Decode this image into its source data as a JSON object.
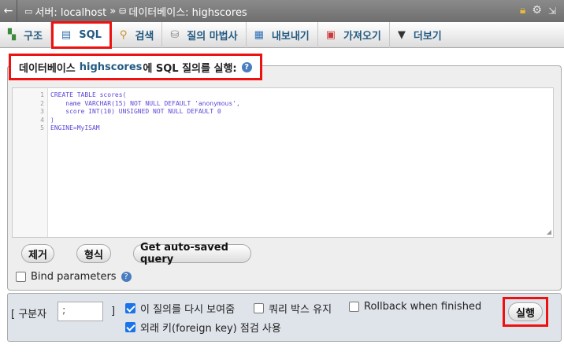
{
  "breadcrumb": {
    "server_label": "서버: localhost",
    "separator": "»",
    "database_label": "데이터베이스: highscores"
  },
  "icons": {
    "back": "back-arrow-icon",
    "server": "server-icon",
    "database": "database-icon",
    "lock": "lock-icon",
    "settings": "gear-icon",
    "collapse": "collapse-icon"
  },
  "tabs": [
    {
      "label": "구조",
      "icon": "structure-icon"
    },
    {
      "label": "SQL",
      "icon": "sql-icon",
      "active": true
    },
    {
      "label": "검색",
      "icon": "search-icon"
    },
    {
      "label": "질의 마법사",
      "icon": "query-icon"
    },
    {
      "label": "내보내기",
      "icon": "export-icon"
    },
    {
      "label": "가져오기",
      "icon": "import-icon"
    },
    {
      "label": "더보기",
      "icon": "caret-down-icon"
    }
  ],
  "sql_panel": {
    "legend_prefix": "데이터베이스",
    "database_name": "highscores",
    "legend_suffix": "에 SQL 질의를 실행:",
    "line_numbers": [
      "1",
      "2",
      "3",
      "4",
      "5"
    ],
    "code_lines": [
      "CREATE TABLE scores(",
      "    name VARCHAR(15) NOT NULL DEFAULT 'anonymous',",
      "    score INT(10) UNSIGNED NOT NULL DEFAULT 0",
      ")",
      "ENGINE=MyISAM"
    ]
  },
  "buttons": {
    "clear": "제거",
    "format": "형식",
    "autosaved": "Get auto-saved query",
    "go": "실행"
  },
  "bind_parameters": {
    "label": "Bind parameters",
    "checked": false
  },
  "options": {
    "delimiter_label": "[ 구분자",
    "delimiter_value": ";",
    "delimiter_close": "]",
    "show_again": {
      "label": "이 질의를 다시 보여줌",
      "checked": true
    },
    "retain_box": {
      "label": "쿼리 박스 유지",
      "checked": false
    },
    "rollback": {
      "label": "Rollback when finished",
      "checked": false
    },
    "foreign_key": {
      "label": "외래 키(foreign key) 점검 사용",
      "checked": true
    }
  },
  "colors": {
    "highlight_border": "#ee1111",
    "link_blue": "#235a81",
    "checkbox_checked": "#1a73e8"
  }
}
